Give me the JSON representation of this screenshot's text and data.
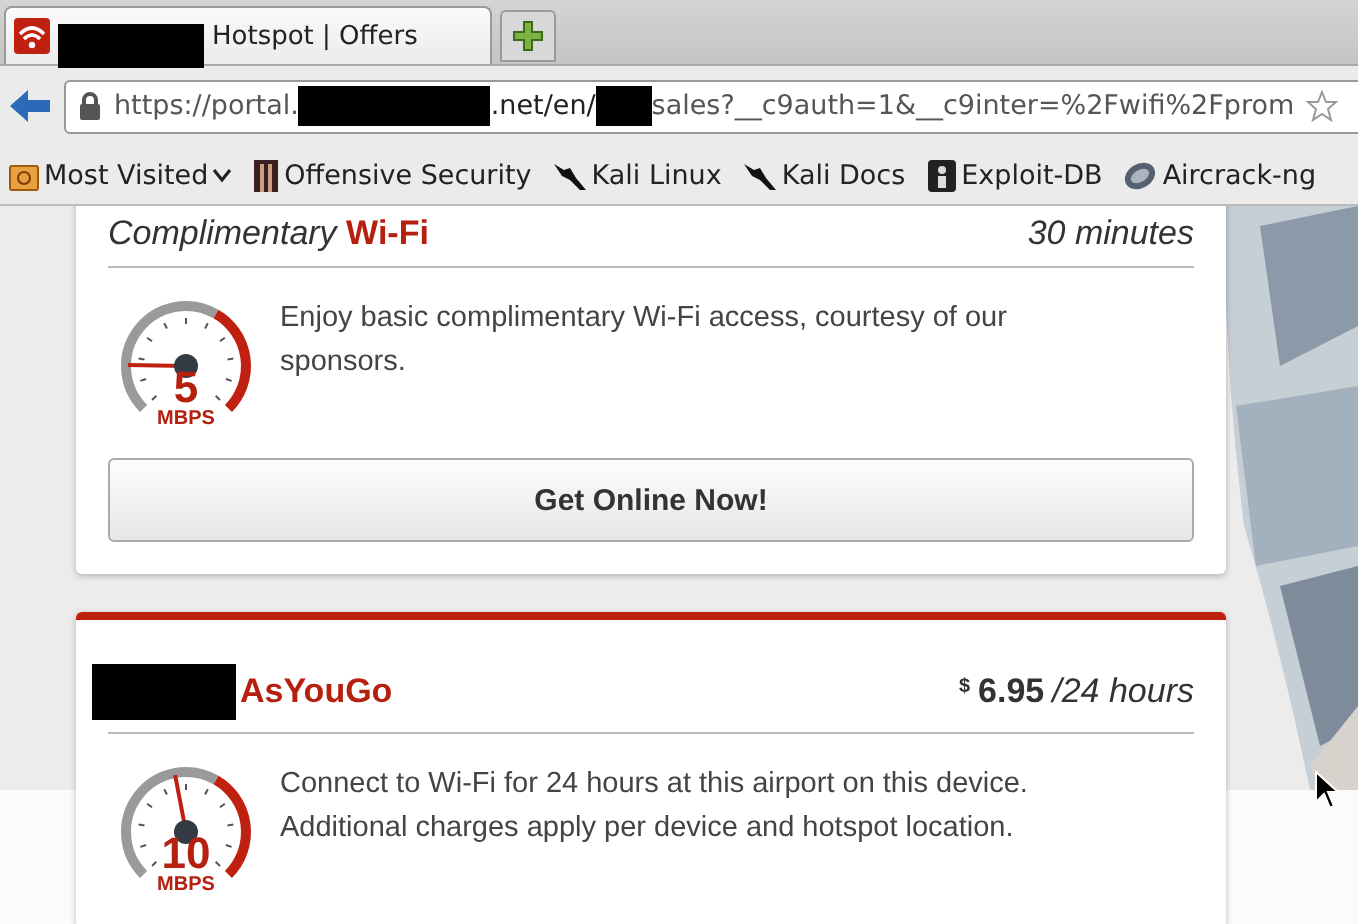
{
  "tabs": [
    {
      "title_parts": [
        {
          "kind": "redacted"
        },
        {
          "kind": "text",
          "text": "Hotspot | Offers"
        }
      ],
      "selected": true
    }
  ],
  "address_bar": {
    "url_parts": [
      {
        "kind": "text",
        "text": "https://portal."
      },
      {
        "kind": "redacted"
      },
      {
        "kind": "text",
        "text": ".net/en/"
      },
      {
        "kind": "redacted"
      },
      {
        "kind": "text",
        "text": "sales?__c9auth=1&__c9inter=%2Fwifi%2Fprom"
      }
    ]
  },
  "bookmarks": [
    {
      "label": "Most Visited",
      "kind": "folder"
    },
    {
      "label": "Offensive Security",
      "kind": "offsec"
    },
    {
      "label": "Kali Linux",
      "kind": "kali"
    },
    {
      "label": "Kali Docs",
      "kind": "kali"
    },
    {
      "label": "Exploit-DB",
      "kind": "exploit"
    },
    {
      "label": "Aircrack-ng",
      "kind": "aircrack"
    }
  ],
  "offers": [
    {
      "title_parts": [
        {
          "kind": "plain",
          "text": "Complimentary "
        },
        {
          "kind": "accent",
          "text": "Wi-Fi"
        }
      ],
      "price": {
        "amount": "30 minutes"
      },
      "highlighted": false,
      "gauge": {
        "level": 0.17,
        "speed": "5",
        "unit": "MBPS"
      },
      "description": "Enjoy basic complimentary Wi-Fi access, courtesy of our sponsors.",
      "button": "Get Online Now!"
    },
    {
      "title_parts": [
        {
          "kind": "redacted"
        },
        {
          "kind": "accent",
          "text": "AsYouGo"
        }
      ],
      "price": {
        "currency": "$",
        "amount": "6.95",
        "period": "/24 hours"
      },
      "highlighted": true,
      "gauge": {
        "level": 0.46,
        "speed": "10",
        "unit": "MBPS"
      },
      "description": "Connect to Wi-Fi for 24 hours at this airport on this device. Additional charges apply per device and hotspot location."
    }
  ]
}
